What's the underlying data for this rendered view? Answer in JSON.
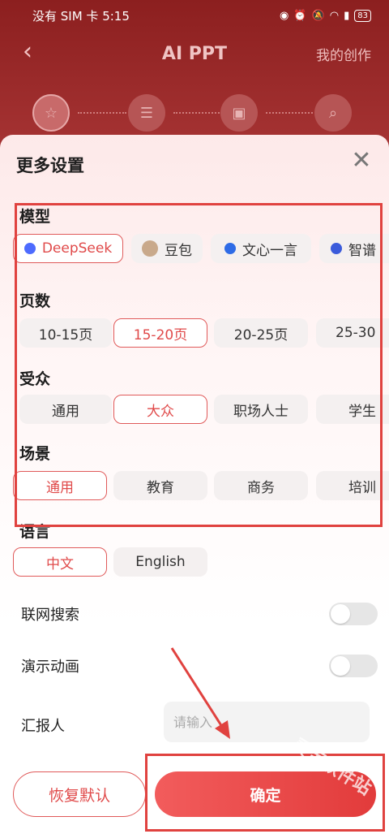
{
  "status_bar": {
    "carrier_time": "没有 SIM 卡 5:15",
    "battery": "83"
  },
  "nav": {
    "title": "AI PPT",
    "right_link": "我的创作"
  },
  "sheet": {
    "title": "更多设置",
    "model": {
      "label": "模型",
      "options": [
        "DeepSeek",
        "豆包",
        "文心一言",
        "智谱"
      ],
      "selected": "DeepSeek"
    },
    "pages": {
      "label": "页数",
      "options": [
        "10-15页",
        "15-20页",
        "20-25页",
        "25-30"
      ],
      "selected": "15-20页"
    },
    "audience": {
      "label": "受众",
      "options": [
        "通用",
        "大众",
        "职场人士",
        "学生"
      ],
      "selected": "大众"
    },
    "scene": {
      "label": "场景",
      "options": [
        "通用",
        "教育",
        "商务",
        "培训"
      ],
      "selected": "通用"
    },
    "language": {
      "label": "语言",
      "options": [
        "中文",
        "English"
      ],
      "selected": "中文"
    },
    "web_search": {
      "label": "联网搜索",
      "enabled": false
    },
    "animation": {
      "label": "演示动画",
      "enabled": false
    },
    "reporter": {
      "label": "汇报人",
      "placeholder": "请输入"
    },
    "reset_label": "恢复默认",
    "confirm_label": "确定"
  },
  "watermark": "灵宝软件站",
  "colors": {
    "accent": "#e04a4a",
    "header_bg": "#8c1f1f",
    "annotation": "#e0423f"
  }
}
